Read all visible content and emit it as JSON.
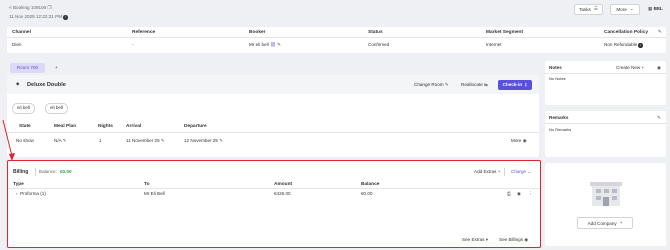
{
  "header": {
    "breadcrumb": "< Booking 109106",
    "date": "11 Nov 2025 12:22:21 PM",
    "tasks_label": "Tasks",
    "more_label": "More",
    "user": "BEL"
  },
  "booking_table": {
    "columns": [
      "Channel",
      "Reference",
      "Booker",
      "Status",
      "Market Segment",
      "Cancellation Policy"
    ],
    "row": {
      "channel": "Dien",
      "reference": "-",
      "booker": "Mr eli bell",
      "status": "Confirmed",
      "market_segment": "Internet",
      "cancellation_policy": "Non Refundable"
    }
  },
  "room": {
    "tab_label": "Room 700",
    "add_tab": "+",
    "room_type": "Deluxe Double",
    "change_room": "Change Room",
    "reallocate": "Reallocate",
    "check_in": "Check-in",
    "guest_chips": [
      "eli bell",
      "eli bell"
    ],
    "columns": [
      "State",
      "Meal Plan",
      "Nights",
      "Arrival",
      "Departure"
    ],
    "stay": {
      "state": "No show",
      "meal_plan": "N/A",
      "nights": "1",
      "arrival": "11 November 25",
      "departure": "12 November 25"
    },
    "more_label": "More"
  },
  "billing": {
    "title": "Billing",
    "balance_label": "Balance:",
    "balance_value": "€0.00",
    "add_extras": "Add Extras",
    "charge": "Charge",
    "columns": [
      "Type",
      "To",
      "Amount",
      "Balance"
    ],
    "row": {
      "type": "Proforma (1)",
      "to": "Mr Eli Bell",
      "amount": "€426.00",
      "balance": "€0.00"
    },
    "see_extras": "See Extras",
    "see_billings": "See Billings"
  },
  "notes": {
    "title": "Notes",
    "create_new": "Create New",
    "empty": "No Notes"
  },
  "remarks": {
    "title": "Remarks",
    "empty": "No Remarks"
  },
  "company": {
    "add_company": "Add Company"
  },
  "colors": {
    "accent": "#5b4fe0",
    "balance_green": "#2a9d4a",
    "highlight_red": "#e0242f"
  }
}
